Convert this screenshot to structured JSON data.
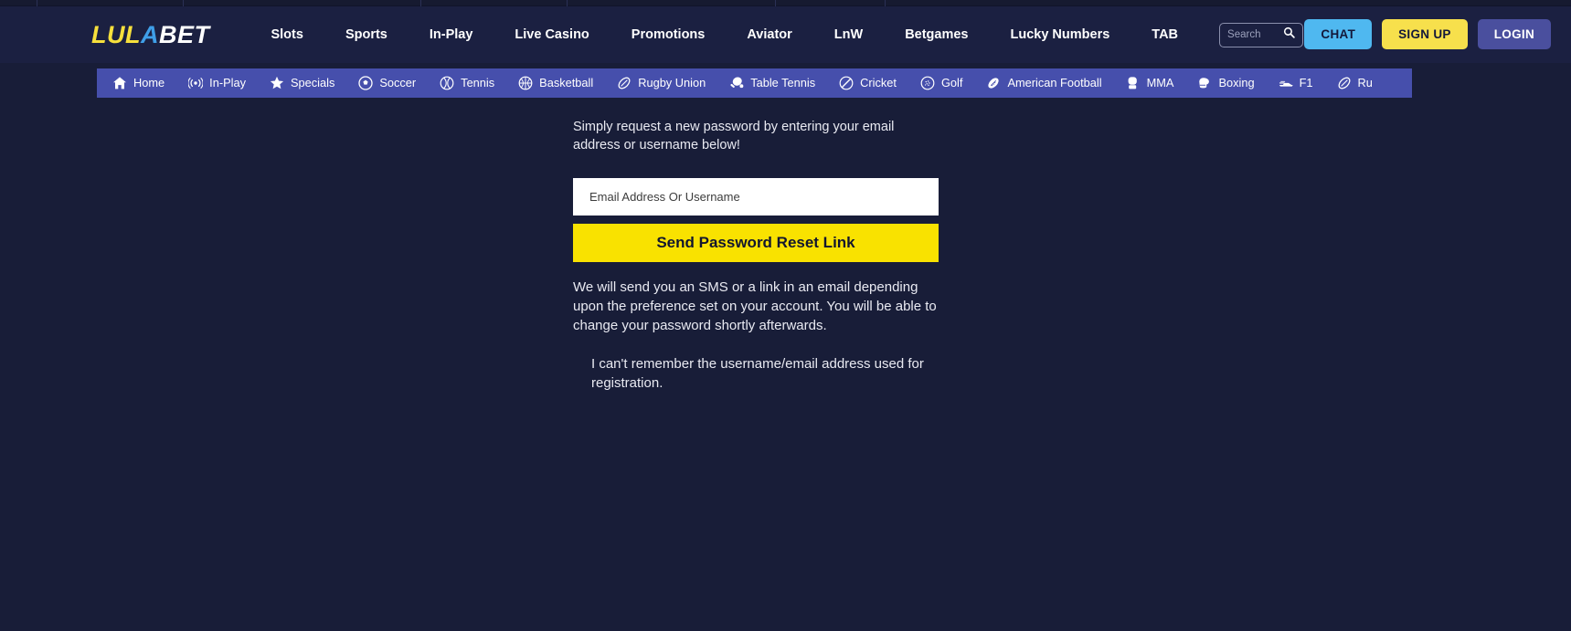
{
  "brand": {
    "logo_part1": "LUL",
    "logo_part2": "A",
    "logo_part3": "BET",
    "colors": {
      "logo_yellow": "#f7e03c",
      "logo_blue": "#3f9fe8",
      "logo_white": "#ffffff",
      "header_bg": "#1b2041",
      "page_bg": "#181d38",
      "subnav_bg": "#464fac",
      "accent_yellow": "#f9e200",
      "chat_blue": "#4fb8f0",
      "login_purple": "#4a4f9e"
    }
  },
  "header": {
    "nav": [
      {
        "label": "Slots"
      },
      {
        "label": "Sports"
      },
      {
        "label": "In-Play"
      },
      {
        "label": "Live Casino"
      },
      {
        "label": "Promotions"
      },
      {
        "label": "Aviator"
      },
      {
        "label": "LnW"
      },
      {
        "label": "Betgames"
      },
      {
        "label": "Lucky Numbers"
      },
      {
        "label": "TAB"
      }
    ],
    "search": {
      "placeholder": "Search",
      "value": "",
      "icon": "search-icon"
    },
    "actions": {
      "chat": "CHAT",
      "signup": "SIGN UP",
      "login": "LOGIN"
    }
  },
  "subnav": {
    "items": [
      {
        "label": "Home",
        "icon": "home-icon"
      },
      {
        "label": "In-Play",
        "icon": "broadcast-icon"
      },
      {
        "label": "Specials",
        "icon": "star-icon"
      },
      {
        "label": "Soccer",
        "icon": "soccer-ball-icon"
      },
      {
        "label": "Tennis",
        "icon": "tennis-ball-icon"
      },
      {
        "label": "Basketball",
        "icon": "basketball-icon"
      },
      {
        "label": "Rugby Union",
        "icon": "rugby-ball-icon"
      },
      {
        "label": "Table Tennis",
        "icon": "table-tennis-paddle-icon"
      },
      {
        "label": "Cricket",
        "icon": "cricket-ball-icon"
      },
      {
        "label": "Golf",
        "icon": "golf-ball-icon"
      },
      {
        "label": "American Football",
        "icon": "american-football-icon"
      },
      {
        "label": "MMA",
        "icon": "mma-glove-icon"
      },
      {
        "label": "Boxing",
        "icon": "boxing-glove-icon"
      },
      {
        "label": "F1",
        "icon": "racing-car-icon"
      },
      {
        "label": "Ru",
        "icon": "rugby-ball-icon"
      }
    ]
  },
  "main": {
    "intro": "Simply request a new password by entering your email address or username below!",
    "input_placeholder": "Email Address Or Username",
    "input_value": "",
    "submit_label": "Send Password Reset Link",
    "note": "We will send you an SMS or a link in an email depending upon the preference set on your account. You will be able to change your password shortly afterwards.",
    "subnote": "I can't remember the username/email address used for registration."
  }
}
